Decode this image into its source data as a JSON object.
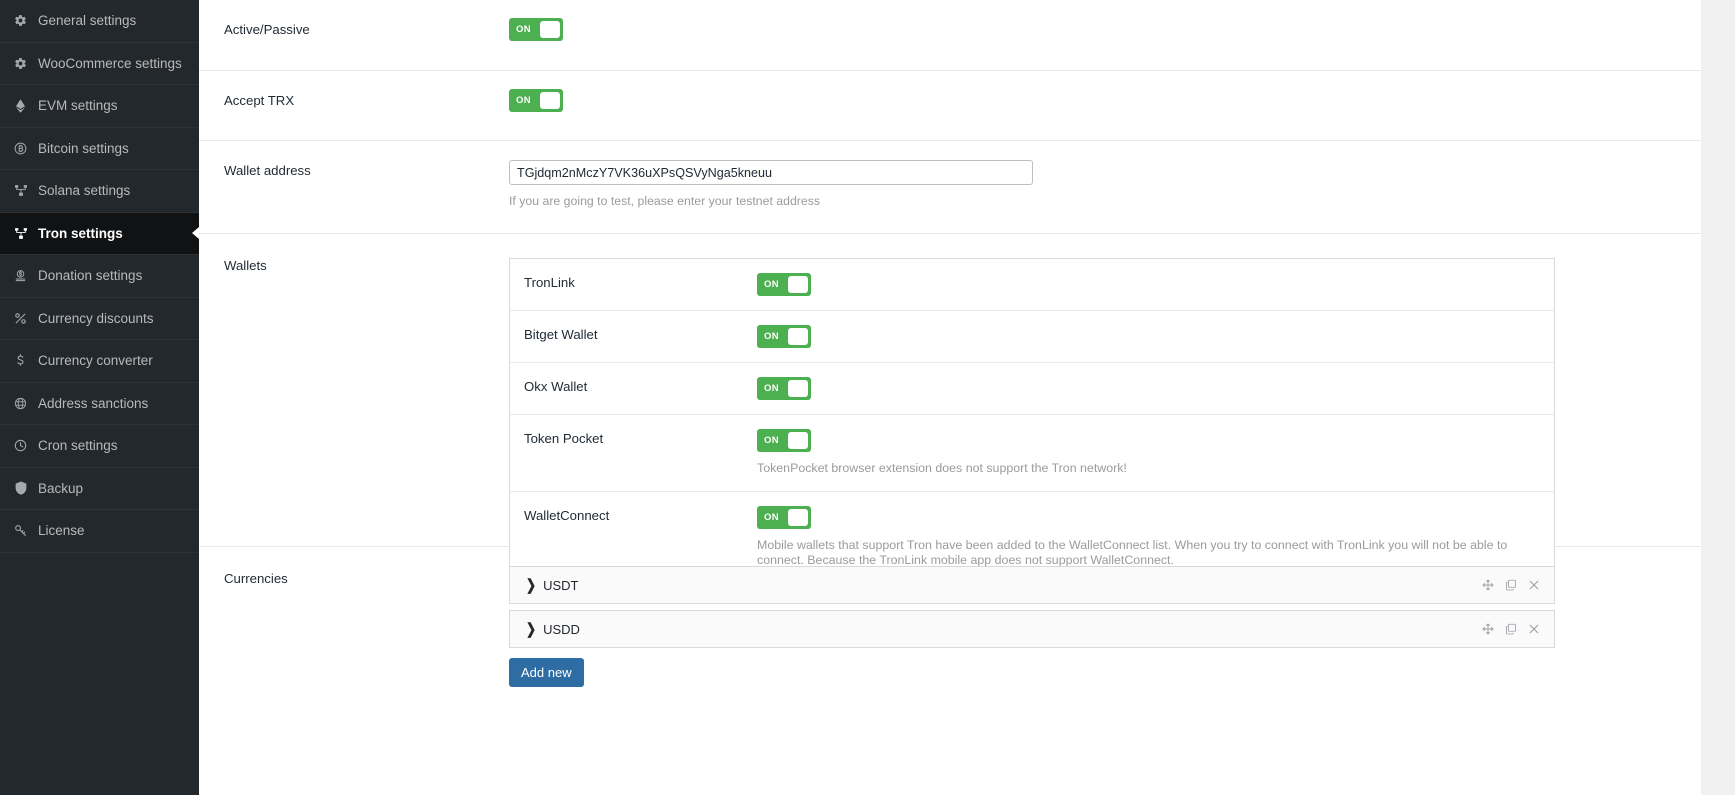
{
  "sidebar": {
    "items": [
      {
        "label": "General settings",
        "icon": "gear-icon",
        "active": false
      },
      {
        "label": "WooCommerce settings",
        "icon": "gear-icon",
        "active": false
      },
      {
        "label": "EVM settings",
        "icon": "ethereum-icon",
        "active": false
      },
      {
        "label": "Bitcoin settings",
        "icon": "bitcoin-icon",
        "active": false
      },
      {
        "label": "Solana settings",
        "icon": "network-icon",
        "active": false
      },
      {
        "label": "Tron settings",
        "icon": "network-icon",
        "active": true
      },
      {
        "label": "Donation settings",
        "icon": "donation-icon",
        "active": false
      },
      {
        "label": "Currency discounts",
        "icon": "percent-icon",
        "active": false
      },
      {
        "label": "Currency converter",
        "icon": "dollar-icon",
        "active": false
      },
      {
        "label": "Address sanctions",
        "icon": "globe-icon",
        "active": false
      },
      {
        "label": "Cron settings",
        "icon": "clock-icon",
        "active": false
      },
      {
        "label": "Backup",
        "icon": "shield-icon",
        "active": false
      },
      {
        "label": "License",
        "icon": "key-icon",
        "active": false
      }
    ]
  },
  "colors": {
    "toggle_on": "#4caf50",
    "button_primary": "#2e6da4",
    "sidebar_bg": "#23282d",
    "sidebar_active_bg": "#101214"
  },
  "settings": {
    "active_passive": {
      "label": "Active/Passive",
      "toggle": "ON",
      "help": "?"
    },
    "accept_trx": {
      "label": "Accept TRX",
      "toggle": "ON",
      "help": "?"
    },
    "wallet_address": {
      "label": "Wallet address",
      "value": "TGjdqm2nMczY7VK36uXPsQSVyNga5kneuu",
      "placeholder": "",
      "hint": "If you are going to test, please enter your testnet address",
      "help": "?"
    },
    "wallets": {
      "label": "Wallets",
      "help": "?",
      "items": [
        {
          "name": "TronLink",
          "toggle": "ON",
          "note": ""
        },
        {
          "name": "Bitget Wallet",
          "toggle": "ON",
          "note": ""
        },
        {
          "name": "Okx Wallet",
          "toggle": "ON",
          "note": ""
        },
        {
          "name": "Token Pocket",
          "toggle": "ON",
          "note": "TokenPocket browser extension does not support the Tron network!"
        },
        {
          "name": "WalletConnect",
          "toggle": "ON",
          "note": "Mobile wallets that support Tron have been added to the WalletConnect list. When you try to connect with TronLink you will not be able to connect. Because the TronLink mobile app does not support WalletConnect."
        }
      ]
    },
    "currencies": {
      "label": "Currencies",
      "help": "?",
      "items": [
        {
          "name": "USDT",
          "chevron": "chevron-right-icon"
        },
        {
          "name": "USDD",
          "chevron": "chevron-right-icon"
        }
      ],
      "add_button": "Add new",
      "actions": {
        "move": "move-icon",
        "duplicate": "duplicate-icon",
        "remove": "close-icon"
      }
    }
  }
}
